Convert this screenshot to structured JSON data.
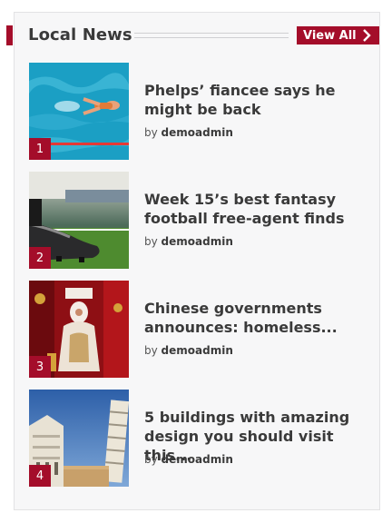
{
  "widget": {
    "title": "Local News",
    "view_all_label": "View All",
    "view_all_icon": "chevron-right-icon",
    "accent_color": "#a40d2a",
    "background_color": "#f7f7f8"
  },
  "articles": [
    {
      "rank": "1",
      "title": "Phelps’ fiancee says he might be back",
      "by": "by",
      "author": "demoadmin",
      "thumbnail": "swimmer-photo"
    },
    {
      "rank": "2",
      "title": "Week 15’s best fantasy football free-agent finds",
      "by": "by",
      "author": "demoadmin",
      "thumbnail": "football-cleat-photo"
    },
    {
      "rank": "3",
      "title": "Chinese governments announces: homeless...",
      "by": "by",
      "author": "demoadmin",
      "thumbnail": "red-shrine-statue-photo"
    },
    {
      "rank": "4",
      "title": "5 buildings with amazing design you should visit this...",
      "by": "by",
      "author": "demoadmin",
      "thumbnail": "pisa-tower-photo"
    }
  ]
}
